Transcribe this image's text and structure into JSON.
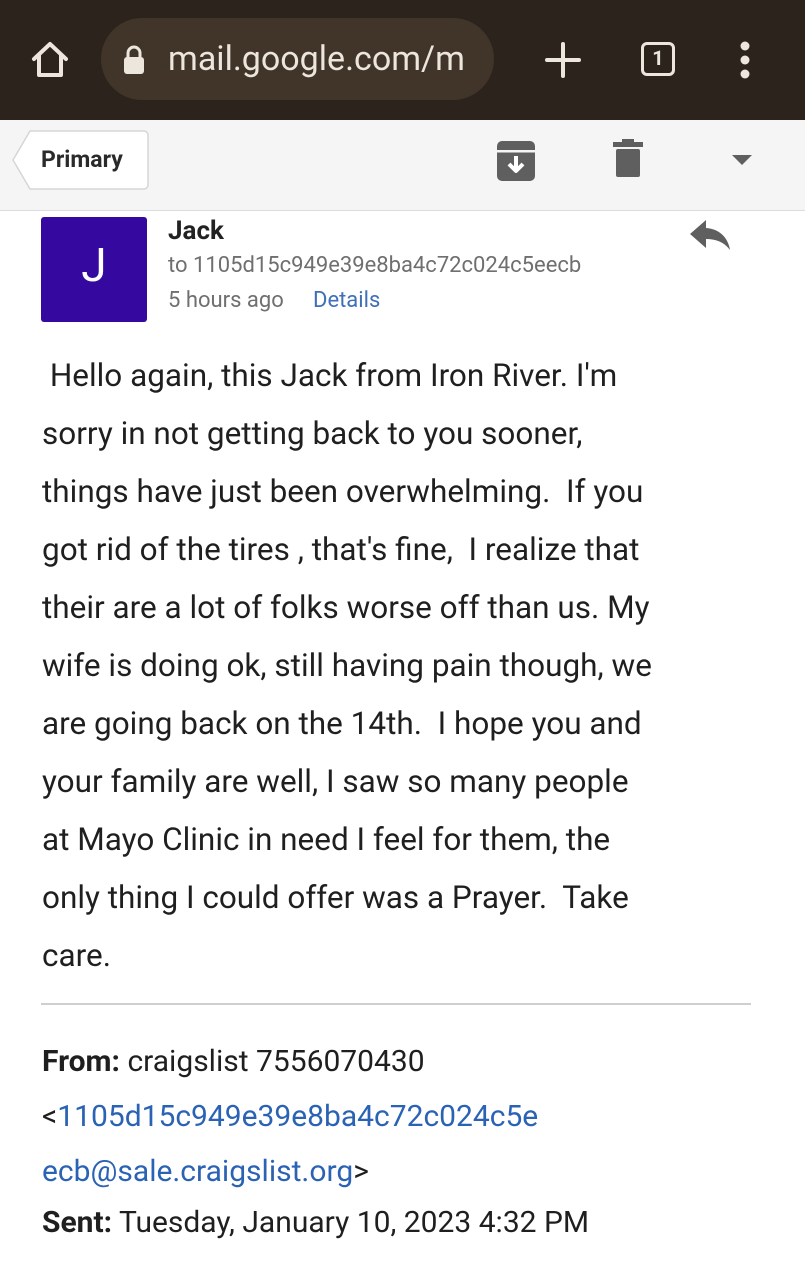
{
  "browser": {
    "url": "mail.google.com/m",
    "tab_count": "1",
    "icons": [
      "home-icon",
      "lock-icon",
      "new-tab-icon",
      "tab-switcher-icon",
      "menu-icon"
    ]
  },
  "toolbar": {
    "back_label": "Primary",
    "icons": [
      "archive-icon",
      "trash-icon",
      "dropdown-icon"
    ]
  },
  "message": {
    "avatar_letter": "J",
    "avatar_color": "#3508a0",
    "sender": "Jack",
    "recipient": "to 1105d15c949e39e8ba4c72c024c5eecb",
    "time": "5 hours ago",
    "details_link": "Details",
    "body_lines": [
      " Hello again, this Jack from Iron River. I'm",
      "sorry in not getting back to you sooner,",
      "things have just been overwhelming.  If you",
      "got rid of the tires , that's fine,  I realize that",
      "their are a lot of folks worse off than us. My",
      "wife is doing ok, still having pain though, we",
      "are going back on the 14th.  I hope you and",
      "your family are well, I saw so many people",
      "at Mayo Clinic in need I feel for them, the",
      "only thing I could offer was a Prayer.  Take",
      "care."
    ]
  },
  "quoted": {
    "from_label": "From:",
    "from_name": "craigslist 7556070430",
    "email_open": "<",
    "email_part1": "1105d15c949e39e8ba4c72c024c5e",
    "email_part2": "ecb@sale.craigslist.org",
    "email_close": ">",
    "sent_label": "Sent:",
    "sent_value": "Tuesday, January 10, 2023 4:32 PM"
  }
}
